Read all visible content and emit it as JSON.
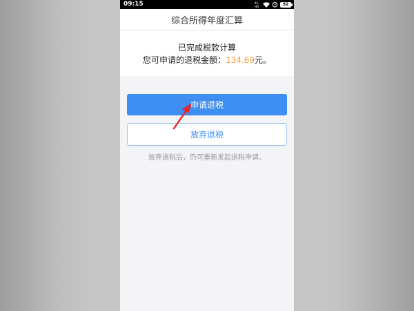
{
  "status_bar": {
    "time": "09:15",
    "network_label": "4G\nHD",
    "battery_level": "92"
  },
  "header": {
    "title": "综合所得年度汇算"
  },
  "result": {
    "completed_text": "已完成税款计算",
    "refund_prefix": "您可申请的退税金额：",
    "refund_amount": "134.69",
    "refund_suffix": "元。"
  },
  "actions": {
    "apply_label": "申请退税",
    "giveup_label": "放弃退税",
    "hint": "放弃退税后，仍可重新发起退税申请。"
  },
  "colors": {
    "primary": "#3f8ef2",
    "amount": "#f39c36",
    "annotation_arrow": "#e8232b"
  },
  "icons": [
    "network-icon",
    "wifi-icon",
    "alarm-icon",
    "battery-icon",
    "annotation-arrow-icon"
  ]
}
